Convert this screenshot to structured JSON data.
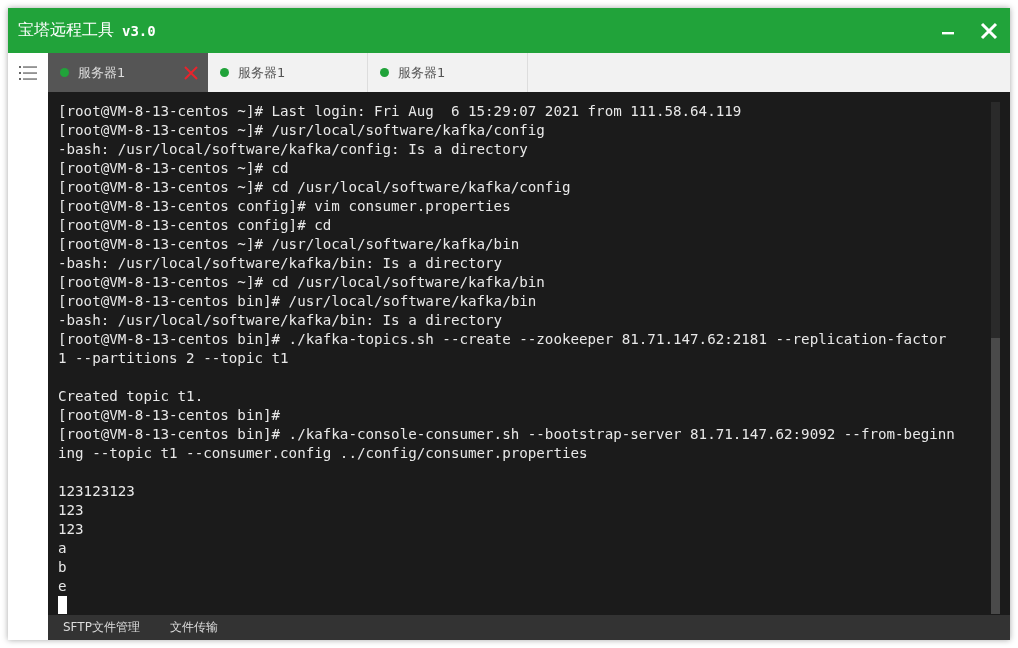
{
  "window": {
    "title": "宝塔远程工具",
    "version": "v3.0"
  },
  "tabs": [
    {
      "label": "服务器1",
      "selected": true,
      "color": "#21a33a"
    },
    {
      "label": "服务器1",
      "selected": false,
      "color": "#21a33a"
    },
    {
      "label": "服务器1",
      "selected": false,
      "color": "#21a33a"
    }
  ],
  "terminal": {
    "lines": [
      {
        "kind": "text",
        "text": "[root@VM-8-13-centos ~]# Last login: Fri Aug  6 15:29:07 2021 from 111.58.64.119"
      },
      {
        "kind": "text",
        "text": "[root@VM-8-13-centos ~]# /usr/local/software/kafka/config"
      },
      {
        "kind": "text",
        "text": "-bash: /usr/local/software/kafka/config: Is a directory"
      },
      {
        "kind": "text",
        "text": "[root@VM-8-13-centos ~]# cd"
      },
      {
        "kind": "text",
        "text": "[root@VM-8-13-centos ~]# cd /usr/local/software/kafka/config"
      },
      {
        "kind": "text",
        "text": "[root@VM-8-13-centos config]# vim consumer.properties"
      },
      {
        "kind": "text",
        "text": "[root@VM-8-13-centos config]# cd"
      },
      {
        "kind": "text",
        "text": "[root@VM-8-13-centos ~]# /usr/local/software/kafka/bin"
      },
      {
        "kind": "text",
        "text": "-bash: /usr/local/software/kafka/bin: Is a directory"
      },
      {
        "kind": "text",
        "text": "[root@VM-8-13-centos ~]# cd /usr/local/software/kafka/bin"
      },
      {
        "kind": "text",
        "text": "[root@VM-8-13-centos bin]# /usr/local/software/kafka/bin"
      },
      {
        "kind": "text",
        "text": "-bash: /usr/local/software/kafka/bin: Is a directory"
      },
      {
        "kind": "text",
        "text": "[root@VM-8-13-centos bin]# ./kafka-topics.sh --create --zookeeper 81.71.147.62:2181 --replication-factor"
      },
      {
        "kind": "text",
        "text": "1 --partitions 2 --topic t1"
      },
      {
        "kind": "blank"
      },
      {
        "kind": "text",
        "text": "Created topic t1."
      },
      {
        "kind": "text",
        "text": "[root@VM-8-13-centos bin]#"
      },
      {
        "kind": "text",
        "text": "[root@VM-8-13-centos bin]# ./kafka-console-consumer.sh --bootstrap-server 81.71.147.62:9092 --from-beginn"
      },
      {
        "kind": "text",
        "text": "ing --topic t1 --consumer.config ../config/consumer.properties"
      },
      {
        "kind": "blank"
      },
      {
        "kind": "text",
        "text": "123123123"
      },
      {
        "kind": "text",
        "text": "123"
      },
      {
        "kind": "text",
        "text": "123"
      },
      {
        "kind": "text",
        "text": "a"
      },
      {
        "kind": "text",
        "text": "b"
      },
      {
        "kind": "text",
        "text": "e"
      },
      {
        "kind": "cursor"
      }
    ]
  },
  "bottom_tabs": [
    "SFTP文件管理",
    "文件传输"
  ]
}
